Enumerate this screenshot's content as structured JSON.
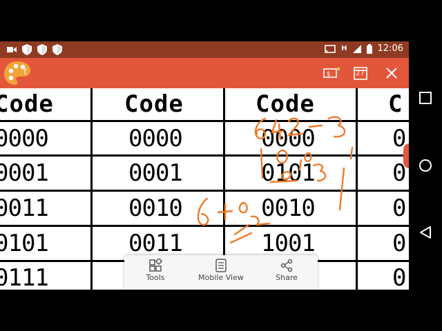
{
  "status_bar": {
    "time": "12:06",
    "network_letter": "H",
    "left_icons": [
      "video-camera-icon",
      "shield-icon",
      "shield-icon",
      "shield-icon"
    ],
    "right_icons": [
      "cast-icon",
      "signal-icon",
      "battery-icon"
    ]
  },
  "app_bar": {
    "title": "t",
    "calendar_badge": "27",
    "actions": [
      "rupee-card-icon",
      "calendar-icon",
      "close-icon"
    ],
    "accent_color": "#e2573b"
  },
  "table": {
    "headers": [
      "Code",
      "Code",
      "Code",
      "C"
    ],
    "columns": [
      [
        "0000",
        "0001",
        "0011",
        "0101",
        "0111"
      ],
      [
        "0000",
        "0001",
        "0010",
        "0011",
        ""
      ],
      [
        "0000",
        "0101",
        "0010",
        "1001",
        ""
      ],
      [
        "0",
        "0",
        "0",
        "0",
        "0"
      ]
    ]
  },
  "bottom_sheet": {
    "items": [
      {
        "label": "Tools",
        "icon": "tools-icon"
      },
      {
        "label": "Mobile View",
        "icon": "mobile-view-icon"
      },
      {
        "label": "Share",
        "icon": "share-icon"
      }
    ]
  },
  "nav_bar": {
    "buttons": [
      "recents-square-icon",
      "home-circle-icon",
      "back-triangle-icon"
    ]
  }
}
